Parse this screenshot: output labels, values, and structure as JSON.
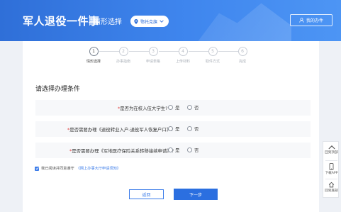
{
  "header": {
    "app_title": "军人退役一件事",
    "page_subtitle": "情形选择",
    "region": "鄂托克旗",
    "my_services": "我的办件"
  },
  "steps": [
    {
      "num": "1",
      "label": "情形选择",
      "active": true
    },
    {
      "num": "2",
      "label": "办事指南",
      "active": false
    },
    {
      "num": "3",
      "label": "申请表格",
      "active": false
    },
    {
      "num": "4",
      "label": "上传材料",
      "active": false
    },
    {
      "num": "5",
      "label": "取件方式",
      "active": false
    },
    {
      "num": "6",
      "label": "完成",
      "active": false
    }
  ],
  "section_title": "请选择办理条件",
  "questions": [
    {
      "required": "*",
      "text": "是否为在校入伍大学生?",
      "yes": "是",
      "no": "否"
    },
    {
      "required": "*",
      "text": "是否需要办理《退役转业入户-退役军人恢复户口》?",
      "yes": "是",
      "no": "否"
    },
    {
      "required": "*",
      "text": "是否需要办理《军地医疗保险关系转移接续申请》?",
      "yes": "是",
      "no": "否"
    }
  ],
  "agreement": {
    "text": "我已阅读并同意遵守",
    "link": "《网上办事大厅申请须知》"
  },
  "buttons": {
    "back": "返回",
    "next": "下一步"
  },
  "floatbar": {
    "top": "回到顶部",
    "download": "下载APP",
    "bottom": "回到底部"
  },
  "colors": {
    "header_blue": "#3a7be9",
    "primary_button": "#2b6fe0",
    "required_mark": "#e23b3b"
  }
}
